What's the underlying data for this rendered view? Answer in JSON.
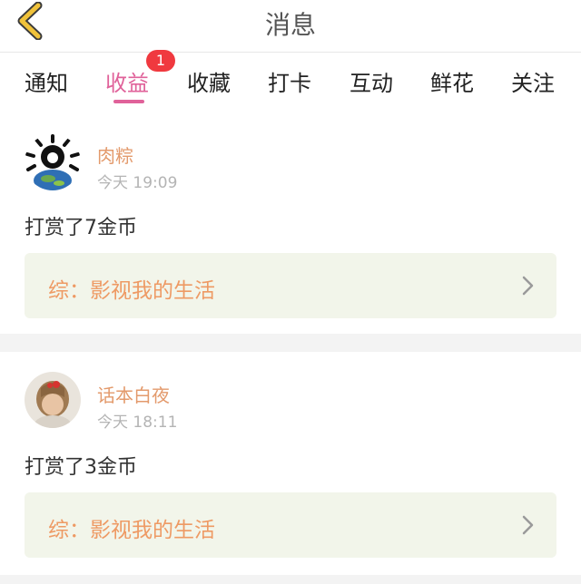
{
  "header": {
    "title": "消息",
    "back_icon": "chevron-left-icon",
    "back_color": "#f0c23a"
  },
  "tabs": [
    {
      "label": "通知",
      "active": false
    },
    {
      "label": "收益",
      "active": true,
      "badge": "1"
    },
    {
      "label": "收藏",
      "active": false
    },
    {
      "label": "打卡",
      "active": false
    },
    {
      "label": "互动",
      "active": false
    },
    {
      "label": "鲜花",
      "active": false
    },
    {
      "label": "关注",
      "active": false
    }
  ],
  "messages": [
    {
      "user": "肉粽",
      "time": "今天 19:09",
      "text": "打赏了7金币",
      "link": "综：影视我的生活"
    },
    {
      "user": "话本白夜",
      "time": "今天 18:11",
      "text": "打赏了3金币",
      "link": "综：影视我的生活"
    }
  ],
  "colors": {
    "accent": "#e0629a",
    "badge": "#f0393f",
    "name": "#e39a6c",
    "link": "#ee9a64",
    "link_bg": "#f2f5ea"
  }
}
